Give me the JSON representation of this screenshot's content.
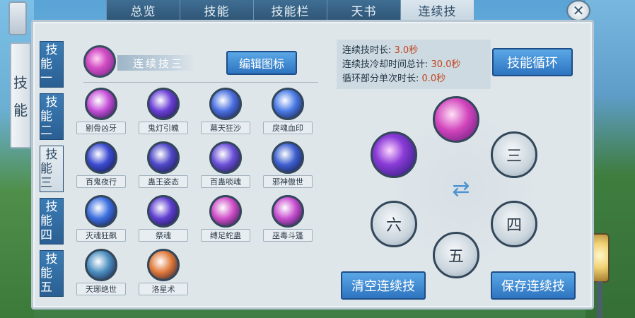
{
  "tabs": [
    "总览",
    "技能",
    "技能栏",
    "天书",
    "连续技"
  ],
  "active_tab": "连续技",
  "side_title": [
    "技",
    "能"
  ],
  "categories": [
    {
      "line1": "技",
      "line2": "能一"
    },
    {
      "line1": "技",
      "line2": "能二"
    },
    {
      "line1": "技",
      "line2": "能三"
    },
    {
      "line1": "技",
      "line2": "能四"
    },
    {
      "line1": "技",
      "line2": "能五"
    }
  ],
  "combo": {
    "name": "连续技三",
    "edit_label": "编辑图标"
  },
  "skills": [
    {
      "label": "剔骨凶牙",
      "color": "#c44fd8"
    },
    {
      "label": "鬼灯引魄",
      "color": "#6b3fd6"
    },
    {
      "label": "幕天狂沙",
      "color": "#4a6fe0"
    },
    {
      "label": "戾魂血印",
      "color": "#4a7be6"
    },
    {
      "label": "百鬼夜行",
      "color": "#3b4bd2"
    },
    {
      "label": "蛊王姿态",
      "color": "#4f48c8"
    },
    {
      "label": "百蛊啖魂",
      "color": "#6a4fd8"
    },
    {
      "label": "邪神傲世",
      "color": "#3d5fd0"
    },
    {
      "label": "灭魂狂飙",
      "color": "#3b6fe0"
    },
    {
      "label": "祭魂",
      "color": "#5f3fd0"
    },
    {
      "label": "缚足蛇蛊",
      "color": "#d04fc8"
    },
    {
      "label": "巫毒斗篷",
      "color": "#c84fd0"
    },
    {
      "label": "天琊绝世",
      "color": "#4c8fc0"
    },
    {
      "label": "洛星术",
      "color": "#e07a3a"
    }
  ],
  "info": {
    "duration_label": "连续技时长:",
    "duration_value": "3.0秒",
    "cooldown_label": "连续技冷却时间总计:",
    "cooldown_value": "30.0秒",
    "loop_label": "循环部分单次时长:",
    "loop_value": "0.0秒"
  },
  "loop_button": "技能循环",
  "slots": [
    "",
    "",
    "三",
    "四",
    "五",
    "六"
  ],
  "clear_button": "清空连续技",
  "save_button": "保存连续技",
  "close_glyph": "✕"
}
